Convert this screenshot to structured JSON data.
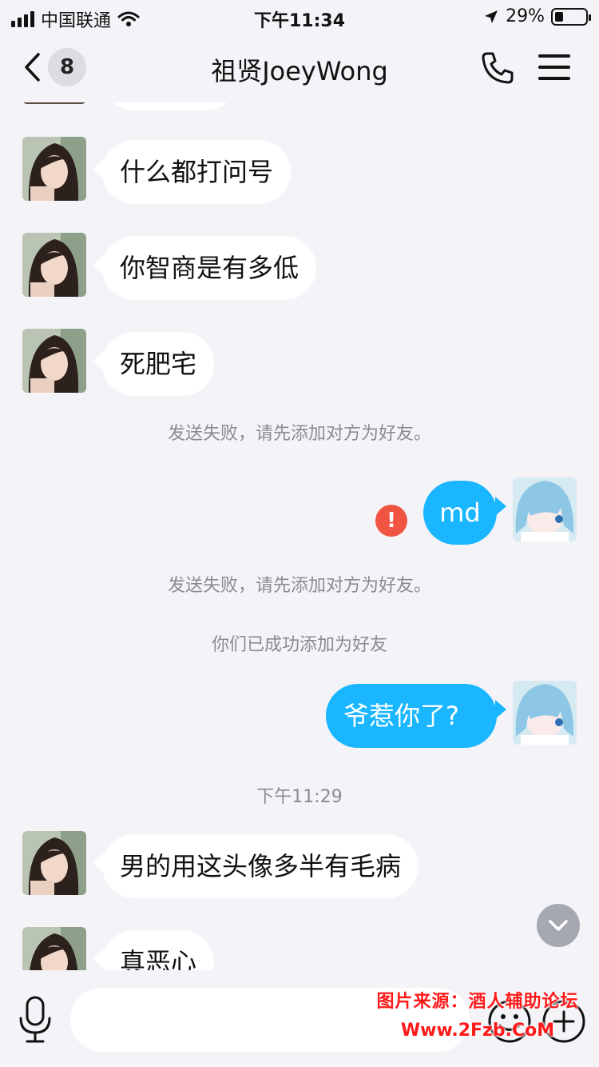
{
  "status_bar": {
    "carrier": "中国联通",
    "time": "下午11:34",
    "battery": "29%",
    "battery_level": 0.29
  },
  "nav": {
    "unread_count": "8",
    "title": "祖贤JoeyWong"
  },
  "chat": {
    "m1": "什么都打问号",
    "m2": "你智商是有多低",
    "m3": "死肥宅",
    "sys1": "发送失败，请先添加对方为好友。",
    "out1": "md",
    "error_mark": "!",
    "sys2": "发送失败，请先添加对方为好友。",
    "sys3": "你们已成功添加为好友",
    "out2": "爷惹你了?",
    "time_divider": "下午11:29",
    "m4": "男的用这头像多半有毛病",
    "m5": "真恶心"
  },
  "input": {
    "placeholder": ""
  },
  "watermark": {
    "line1": "图片来源：酒人辅助论坛",
    "line2": "Www.2Fzb.CoM"
  },
  "colors": {
    "background": "#f4f4f8",
    "outgoing_bubble": "#1ab6ff",
    "incoming_bubble": "#ffffff",
    "error": "#f05544",
    "system_text": "#8a8b90"
  }
}
